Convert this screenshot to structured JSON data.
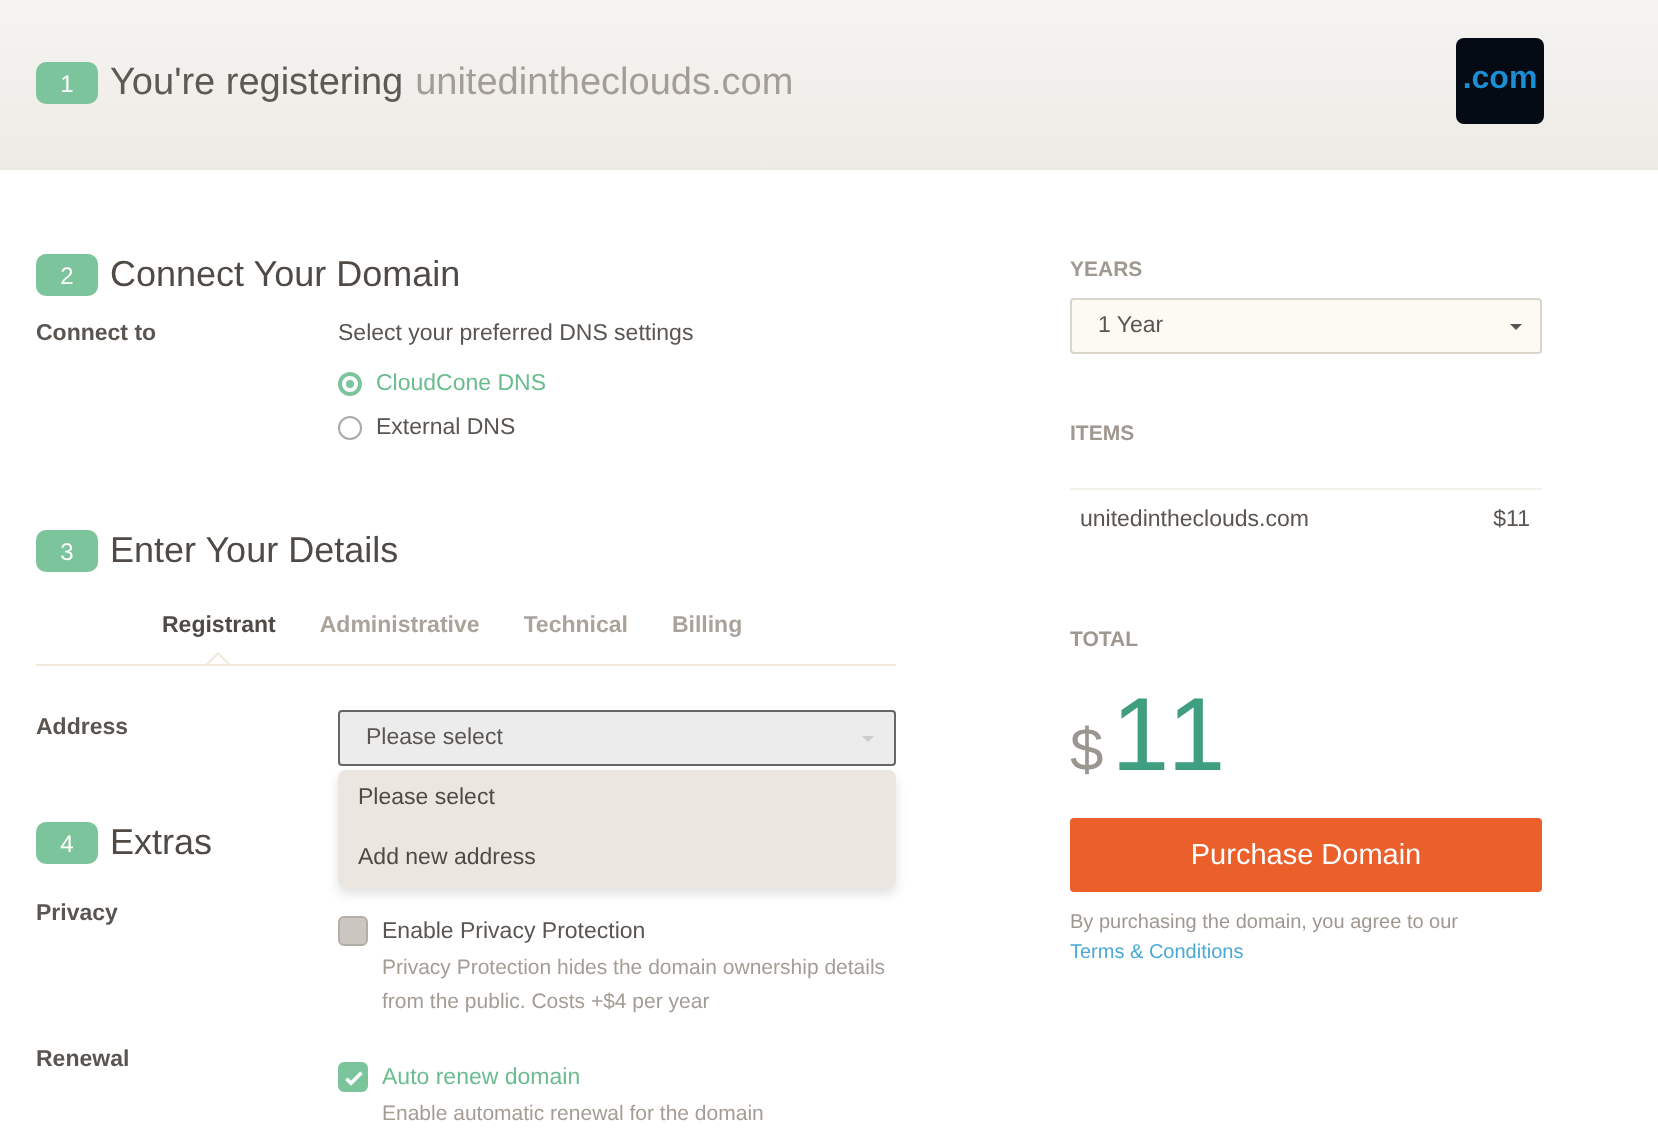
{
  "header": {
    "step": "1",
    "title": "You're registering",
    "domain": "unitedintheclouds.com",
    "logo_text": ".com"
  },
  "connect": {
    "step": "2",
    "title": "Connect Your Domain",
    "label": "Connect to",
    "hint": "Select your preferred DNS settings",
    "options": [
      {
        "label": "CloudCone DNS",
        "selected": true
      },
      {
        "label": "External DNS",
        "selected": false
      }
    ]
  },
  "details": {
    "step": "3",
    "title": "Enter Your Details",
    "tabs": [
      {
        "label": "Registrant",
        "selected": true
      },
      {
        "label": "Administrative",
        "selected": false
      },
      {
        "label": "Technical",
        "selected": false
      },
      {
        "label": "Billing",
        "selected": false
      }
    ],
    "address": {
      "label": "Address",
      "value": "Please select",
      "expanded": true,
      "options": [
        "Please select",
        "Add new address"
      ]
    }
  },
  "extras": {
    "step": "4",
    "title": "Extras",
    "items": [
      {
        "label": "Privacy",
        "option": "Enable Privacy Protection",
        "description": "Privacy Protection hides the domain ownership details from the public. Costs +$4 per year",
        "checked": false
      },
      {
        "label": "Renewal",
        "option": "Auto renew domain",
        "description": "Enable automatic renewal for the domain",
        "checked": true
      }
    ]
  },
  "summary": {
    "years_label": "YEARS",
    "years_value": "1 Year",
    "items_label": "ITEMS",
    "items": [
      {
        "name": "unitedintheclouds.com",
        "price": "$11"
      }
    ],
    "total_label": "TOTAL",
    "currency": "$",
    "total": "11",
    "button": "Purchase Domain",
    "note": "By purchasing the domain, you agree to our",
    "note_link": "Terms & Conditions"
  }
}
